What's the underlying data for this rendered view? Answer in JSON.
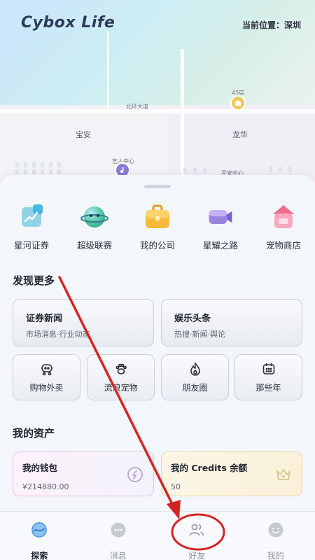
{
  "header": {
    "brand": "Cybox Life",
    "location": "当前位置：深圳"
  },
  "map": {
    "labels": {
      "road_north": "北环大道",
      "district_left": "宝安",
      "district_right": "龙华",
      "poi_artist": "艺人中心",
      "poi_center": "平安中心",
      "poi_45": "45店"
    }
  },
  "apps": [
    {
      "label": "星河证券",
      "icon": "chart-icon"
    },
    {
      "label": "超级联赛",
      "icon": "planet-icon"
    },
    {
      "label": "我的公司",
      "icon": "briefcase-icon"
    },
    {
      "label": "星耀之路",
      "icon": "camera-icon"
    },
    {
      "label": "宠物商店",
      "icon": "pet-shop-icon"
    }
  ],
  "discover": {
    "title": "发现更多",
    "cards": [
      {
        "title": "证券新闻",
        "subtitle": "市场消息·行业动态"
      },
      {
        "title": "娱乐头条",
        "subtitle": "热搜·新闻·舆论"
      }
    ],
    "tiles": [
      {
        "label": "购物外卖",
        "icon": "cart-icon"
      },
      {
        "label": "流浪宠物",
        "icon": "paw-icon"
      },
      {
        "label": "朋友圈",
        "icon": "flame-icon"
      },
      {
        "label": "那些年",
        "icon": "calendar-icon"
      }
    ]
  },
  "assets": {
    "title": "我的资产",
    "wallet": {
      "title": "我的钱包",
      "value": "¥214880.00"
    },
    "credits": {
      "title": "我的 Credits 余额",
      "value": "50"
    }
  },
  "tabs": [
    {
      "label": "探索",
      "icon": "explore-icon",
      "active": true
    },
    {
      "label": "消息",
      "icon": "message-icon",
      "active": false
    },
    {
      "label": "好友",
      "icon": "friends-icon",
      "active": false
    },
    {
      "label": "我的",
      "icon": "profile-icon",
      "active": false
    }
  ],
  "colors": {
    "annotation": "#d22626",
    "accent_blue": "#3b8fe0"
  }
}
